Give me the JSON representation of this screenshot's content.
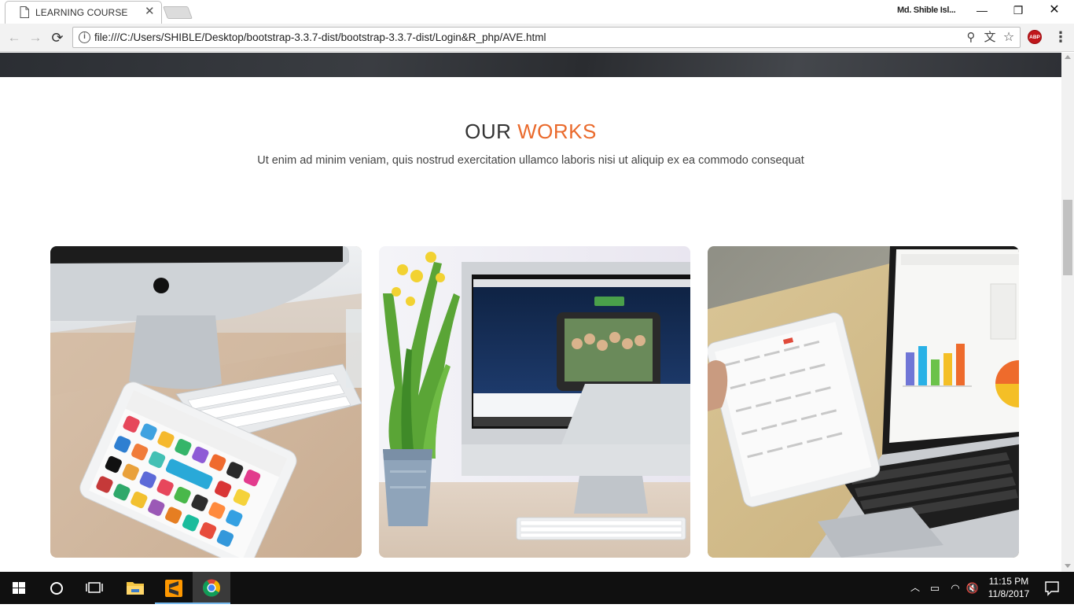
{
  "browser": {
    "tab": {
      "title": "LEARNING COURSE",
      "close": "✕"
    },
    "profile_name": "Md. Shible Isl...",
    "window_controls": {
      "minimize": "—",
      "restore": "❐",
      "close": "✕"
    },
    "nav": {
      "back": "←",
      "forward": "→",
      "reload": "⟳"
    },
    "address_bar": {
      "url": "file:///C:/Users/SHIBLE/Desktop/bootstrap-3.3.7-dist/bootstrap-3.3.7-dist/Login&R_php/AVE.html",
      "info_icon": "i"
    },
    "omnibox_icons": {
      "zoom": "⚲",
      "translate": "文",
      "bookmark": "☆"
    },
    "extension_abp": "ABP",
    "menu": "⋮"
  },
  "page": {
    "heading": {
      "part1": "OUR ",
      "part2": "WORKS"
    },
    "subtitle": "Ut enim ad minim veniam, quis nostrud exercitation ullamco laboris nisi ut aliquip ex ea commodo consequat",
    "works": [
      {
        "name": "iMac, keyboard and iPad on wooden desk"
      },
      {
        "name": "iMac with Facebook for iPad page and plant"
      },
      {
        "name": "MacBook with bar chart and iPad calendar"
      }
    ],
    "accent_color": "#ea6a2c"
  },
  "taskbar": {
    "clock": {
      "time": "11:15 PM",
      "date": "11/8/2017"
    },
    "tray": {
      "chevron": "︿",
      "battery": "▭",
      "wifi": "◠",
      "volume": "🔇"
    }
  }
}
